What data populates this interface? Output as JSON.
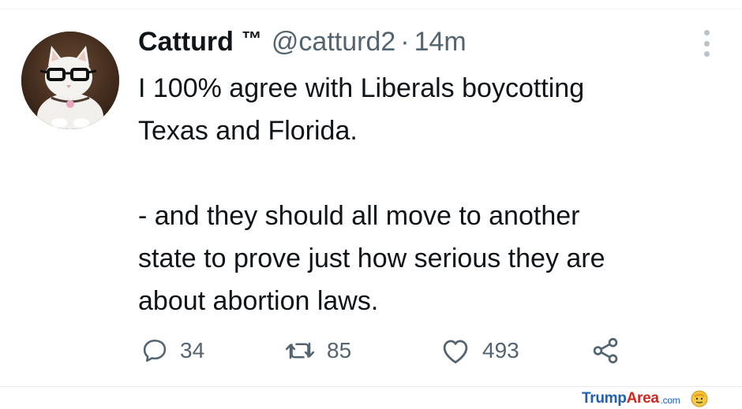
{
  "tweet": {
    "display_name": "Catturd",
    "trademark": "™",
    "handle": "@catturd2",
    "separator": "·",
    "time": "14m",
    "text_lines": [
      "I 100% agree with Liberals boycotting",
      "Texas and Florida.",
      "- and they should all move to another",
      "state to prove just how serious they are",
      "about abortion laws."
    ]
  },
  "actions": {
    "reply_count": "34",
    "retweet_count": "85",
    "like_count": "493"
  },
  "icons": {
    "reply": "reply-icon",
    "retweet": "retweet-icon",
    "like": "heart-icon",
    "share": "share-icon",
    "more": "more-options-icon"
  },
  "watermark": {
    "part1": "Trump",
    "part2": "Area",
    "part3": ".com"
  },
  "colors": {
    "text": "#0f1419",
    "secondary": "#536471",
    "watermark_blue": "#1f5fb4",
    "watermark_red": "#d4251f"
  }
}
